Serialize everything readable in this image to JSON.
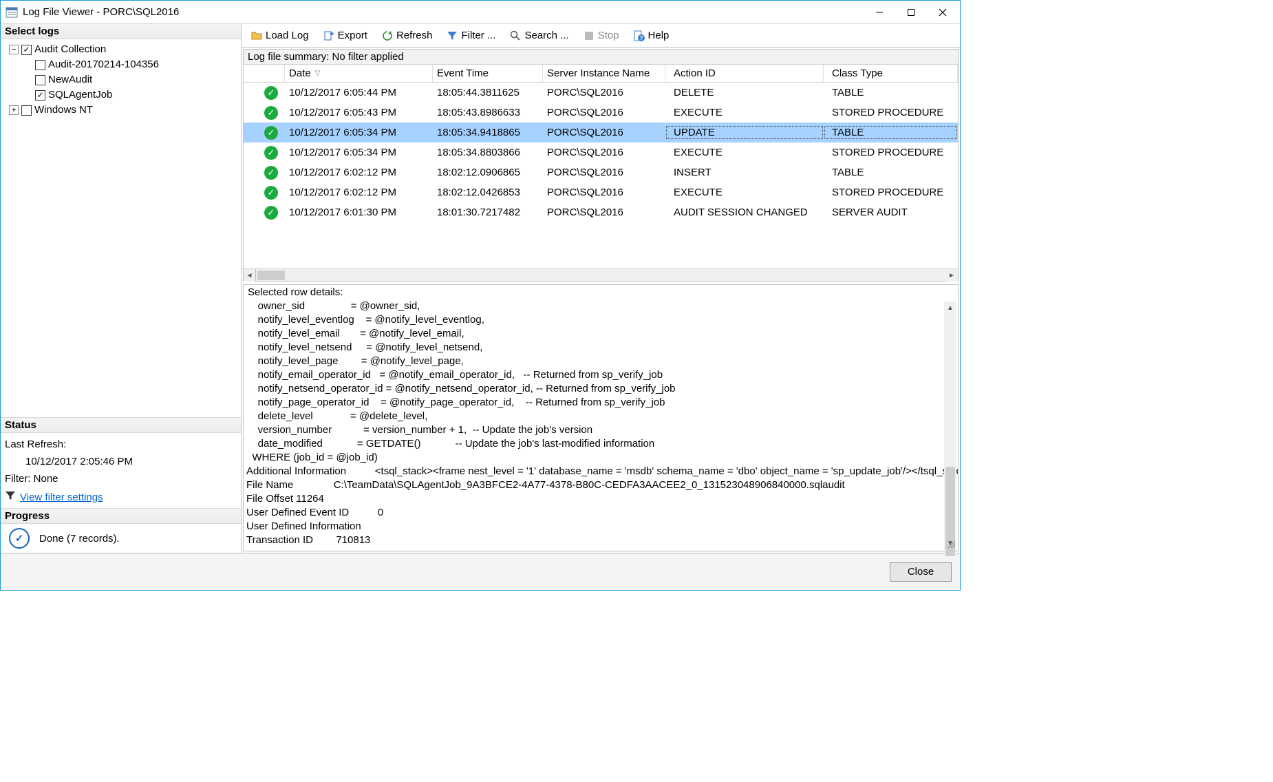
{
  "window": {
    "title": "Log File Viewer - PORC\\SQL2016"
  },
  "left_panel": {
    "select_logs_header": "Select logs",
    "tree": {
      "root": {
        "label": "Audit Collection",
        "checked": true,
        "children": [
          {
            "label": "Audit-20170214-104356",
            "checked": false
          },
          {
            "label": "NewAudit",
            "checked": false
          },
          {
            "label": "SQLAgentJob",
            "checked": true
          }
        ]
      },
      "windows_nt": {
        "label": "Windows NT",
        "checked": false
      }
    },
    "status": {
      "header": "Status",
      "last_refresh_label": "Last Refresh:",
      "last_refresh_value": "10/12/2017 2:05:46 PM",
      "filter_label": "Filter: None",
      "filter_link": "View filter settings"
    },
    "progress": {
      "header": "Progress",
      "text": "Done (7 records)."
    }
  },
  "toolbar": {
    "load_log": "Load Log",
    "export": "Export",
    "refresh": "Refresh",
    "filter": "Filter ...",
    "search": "Search ...",
    "stop": "Stop",
    "help": "Help"
  },
  "grid": {
    "summary": "Log file summary: No filter applied",
    "columns": {
      "date": "Date",
      "event_time": "Event Time",
      "server": "Server Instance Name",
      "action": "Action ID",
      "class": "Class Type"
    },
    "rows": [
      {
        "date": "10/12/2017 6:05:44 PM",
        "time": "18:05:44.3811625",
        "server": "PORC\\SQL2016",
        "action": "DELETE",
        "cls": "TABLE",
        "selected": false
      },
      {
        "date": "10/12/2017 6:05:43 PM",
        "time": "18:05:43.8986633",
        "server": "PORC\\SQL2016",
        "action": "EXECUTE",
        "cls": "STORED PROCEDURE",
        "selected": false
      },
      {
        "date": "10/12/2017 6:05:34 PM",
        "time": "18:05:34.9418865",
        "server": "PORC\\SQL2016",
        "action": "UPDATE",
        "cls": "TABLE",
        "selected": true
      },
      {
        "date": "10/12/2017 6:05:34 PM",
        "time": "18:05:34.8803866",
        "server": "PORC\\SQL2016",
        "action": "EXECUTE",
        "cls": "STORED PROCEDURE",
        "selected": false
      },
      {
        "date": "10/12/2017 6:02:12 PM",
        "time": "18:02:12.0906865",
        "server": "PORC\\SQL2016",
        "action": "INSERT",
        "cls": "TABLE",
        "selected": false
      },
      {
        "date": "10/12/2017 6:02:12 PM",
        "time": "18:02:12.0426853",
        "server": "PORC\\SQL2016",
        "action": "EXECUTE",
        "cls": "STORED PROCEDURE",
        "selected": false
      },
      {
        "date": "10/12/2017 6:01:30 PM",
        "time": "18:01:30.7217482",
        "server": "PORC\\SQL2016",
        "action": "AUDIT SESSION CHANGED",
        "cls": "SERVER AUDIT",
        "selected": false
      }
    ]
  },
  "details": {
    "header": "Selected row details:",
    "body": "    owner_sid                = @owner_sid,\n    notify_level_eventlog    = @notify_level_eventlog,\n    notify_level_email       = @notify_level_email,\n    notify_level_netsend     = @notify_level_netsend,\n    notify_level_page        = @notify_level_page,\n    notify_email_operator_id   = @notify_email_operator_id,   -- Returned from sp_verify_job\n    notify_netsend_operator_id = @notify_netsend_operator_id, -- Returned from sp_verify_job\n    notify_page_operator_id    = @notify_page_operator_id,    -- Returned from sp_verify_job\n    delete_level             = @delete_level,\n    version_number           = version_number + 1,  -- Update the job's version\n    date_modified            = GETDATE()            -- Update the job's last-modified information\n  WHERE (job_id = @job_id)\nAdditional Information          <tsql_stack><frame nest_level = '1' database_name = 'msdb' schema_name = 'dbo' object_name = 'sp_update_job'/></tsql_stack>\nFile Name              C:\\TeamData\\SQLAgentJob_9A3BFCE2-4A77-4378-B80C-CEDFA3AACEE2_0_131523048906840000.sqlaudit\nFile Offset 11264\nUser Defined Event ID          0\nUser Defined Information\nTransaction ID        710813"
  },
  "footer": {
    "close": "Close"
  }
}
